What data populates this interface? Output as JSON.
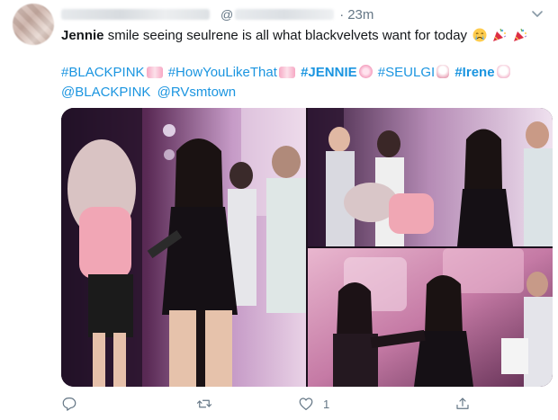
{
  "tweet": {
    "time_separator": "·",
    "time": "23m",
    "handle_prefix": "@",
    "text": {
      "bold_name": "Jennie",
      "rest": " smile seeing seulrene is all what blackvelvets want for today"
    },
    "hashtags_line1": [
      {
        "label": "#BLACKPINK",
        "bold": false
      },
      {
        "label": "#HowYouLikeThat",
        "bold": false
      },
      {
        "label": "#JENNIE",
        "bold": true
      },
      {
        "label": "#SEULGI",
        "bold": false
      },
      {
        "label": "#Irene",
        "bold": true
      }
    ],
    "mentions": [
      "@BLACKPINK",
      "@RVsmtown"
    ]
  },
  "actions": {
    "reply_count": "",
    "retweet_count": "",
    "like_count": "1",
    "share_count": ""
  },
  "colors": {
    "link": "#1b95e0",
    "secondary": "#657786",
    "text": "#14171a"
  },
  "icons": [
    "caret-down-icon",
    "reply-icon",
    "retweet-icon",
    "like-icon",
    "share-icon"
  ]
}
